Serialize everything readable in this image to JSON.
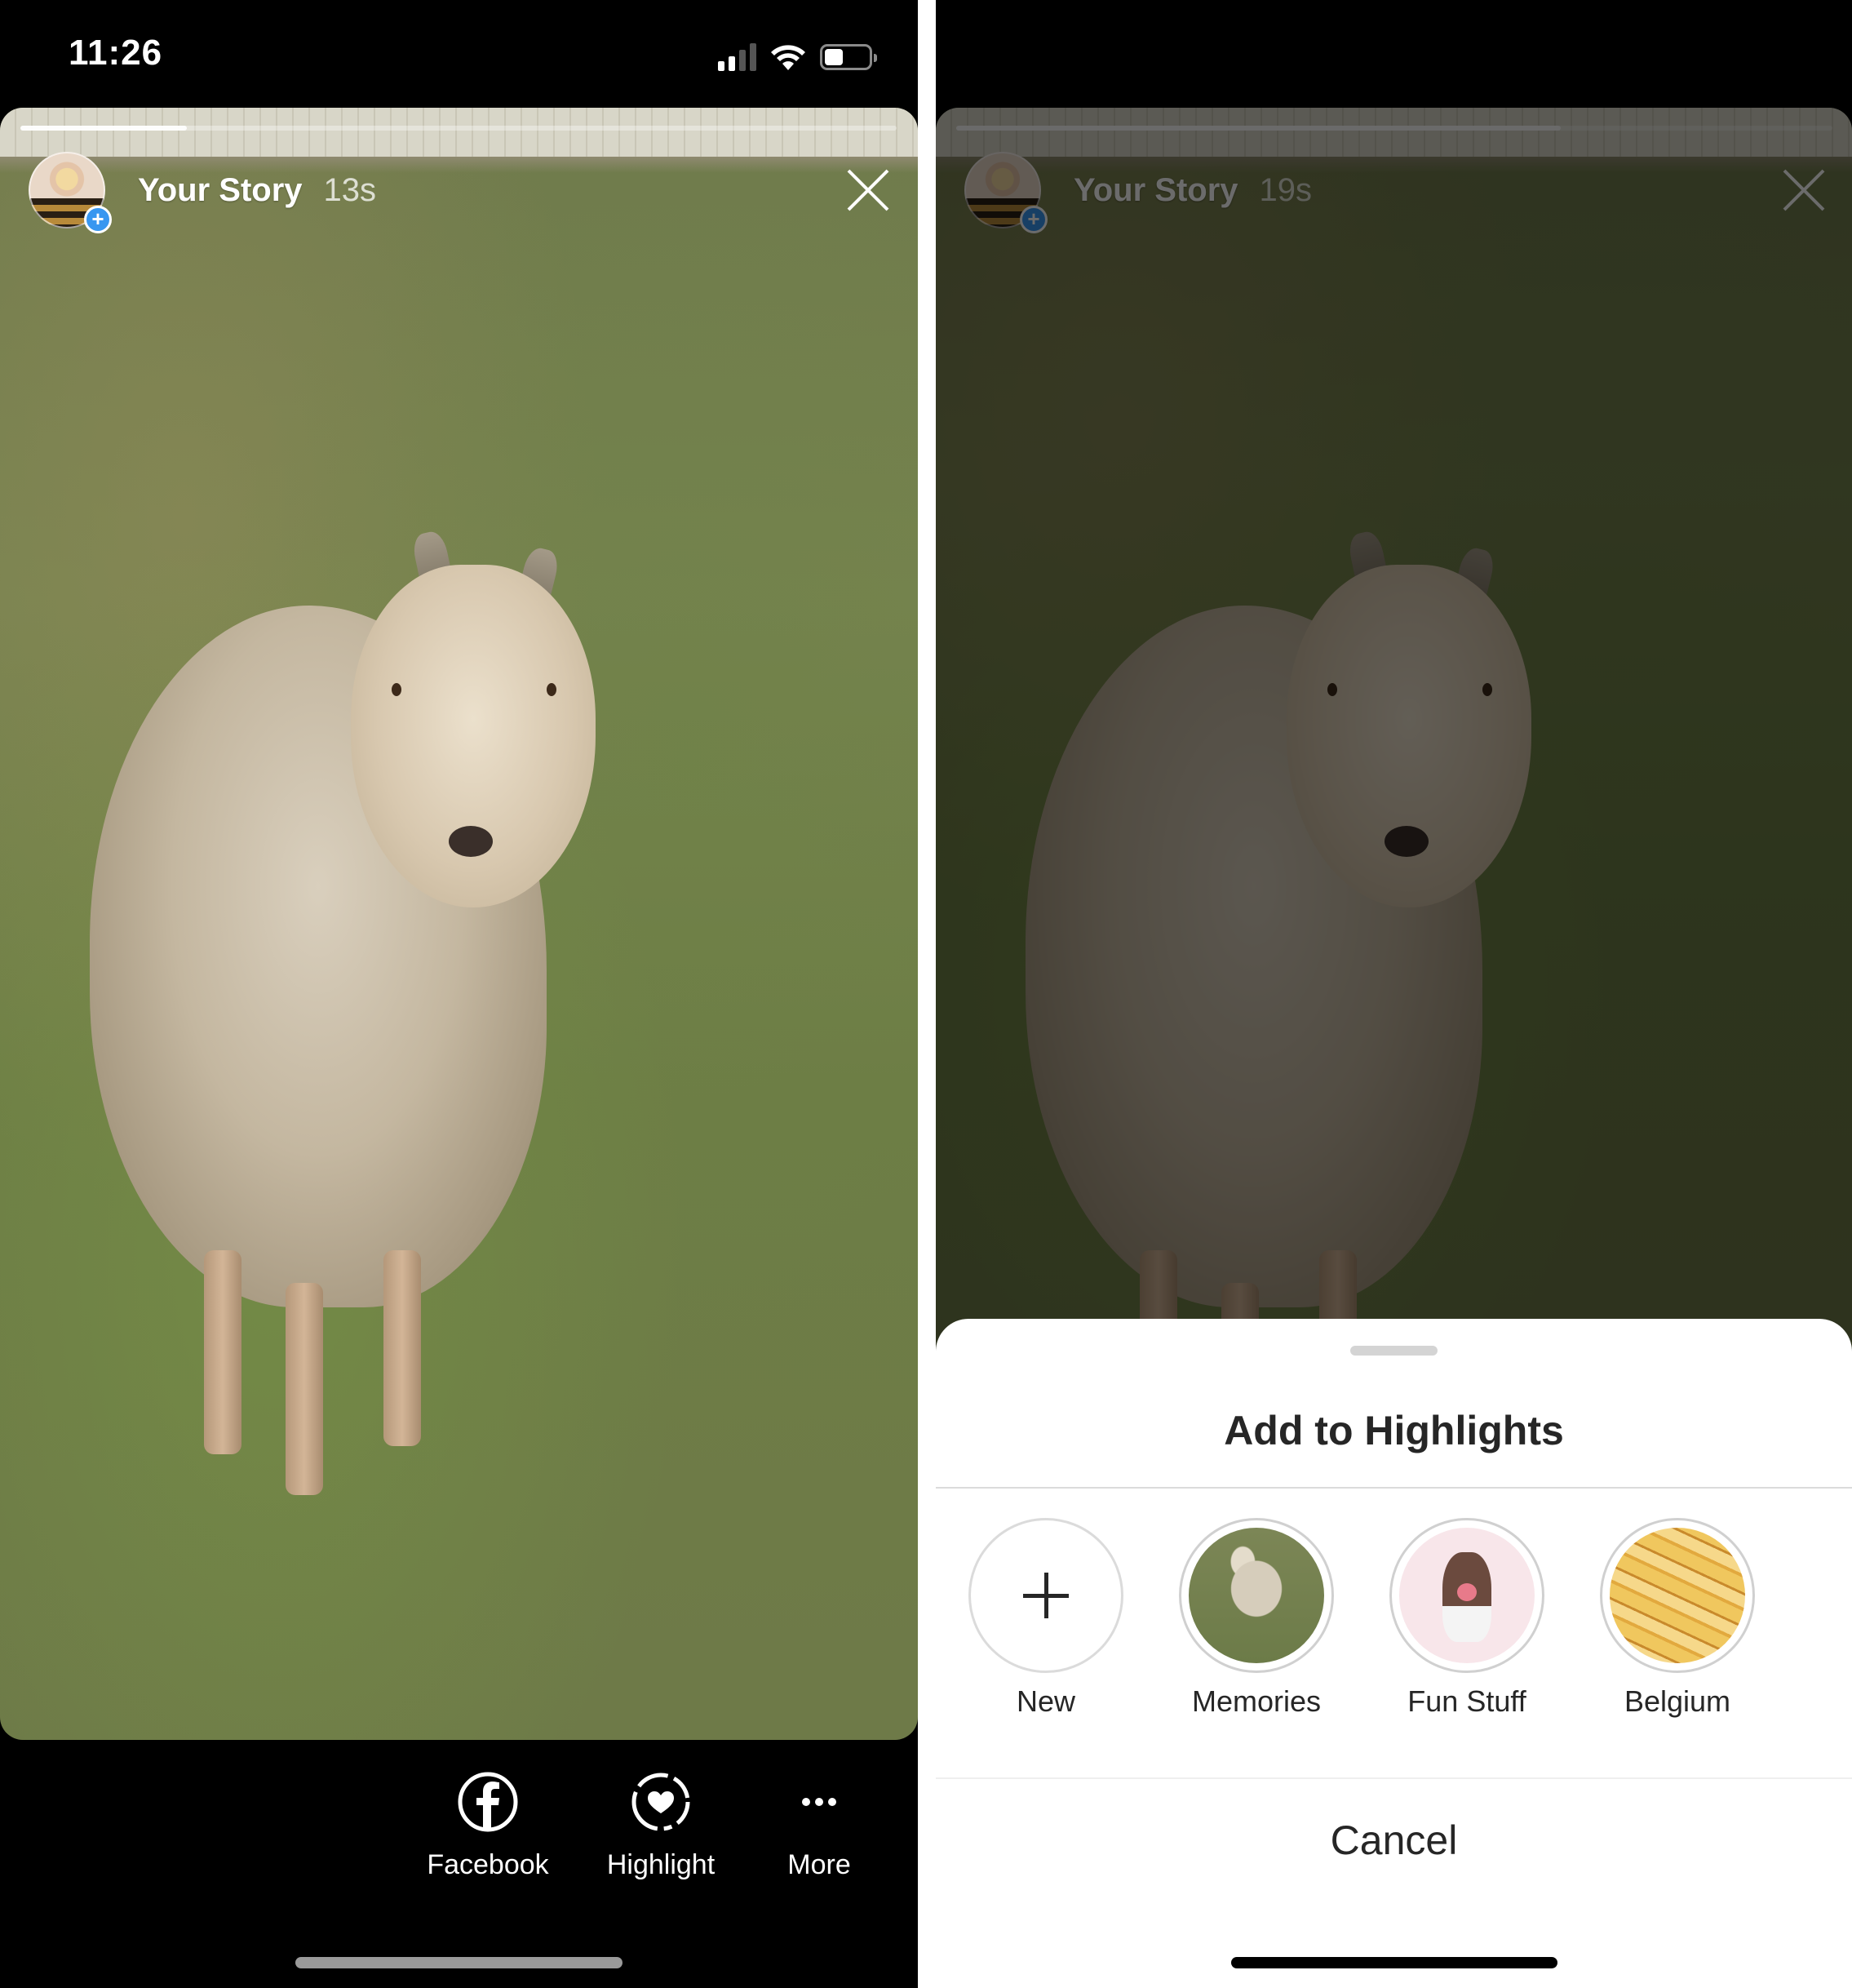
{
  "left_screen": {
    "status_bar": {
      "time": "11:26",
      "signal_bars_active": 2,
      "signal_bars_total": 4,
      "battery_level": 0.4
    },
    "story": {
      "progress": 0.19,
      "user_label": "Your Story",
      "age": "13s",
      "avatar_badge": "+"
    },
    "actions": [
      {
        "label": "Facebook",
        "icon": "facebook-icon"
      },
      {
        "label": "Highlight",
        "icon": "highlight-heart-icon"
      },
      {
        "label": "More",
        "icon": "more-dots-icon"
      }
    ]
  },
  "right_screen": {
    "story": {
      "progress": 0.69,
      "user_label": "Your Story",
      "age": "19s",
      "avatar_badge": "+"
    },
    "sheet": {
      "title": "Add to Highlights",
      "highlights": [
        {
          "label": "New",
          "thumb": "plus-icon"
        },
        {
          "label": "Memories",
          "thumb": "goat-photo"
        },
        {
          "label": "Fun Stuff",
          "thumb": "dog-illustration"
        },
        {
          "label": "Belgium",
          "thumb": "fries-photo"
        }
      ],
      "cancel_label": "Cancel"
    }
  },
  "colors": {
    "badge_blue": "#3897f0",
    "sheet_text": "#262626",
    "divider": "#dbdbdb"
  }
}
